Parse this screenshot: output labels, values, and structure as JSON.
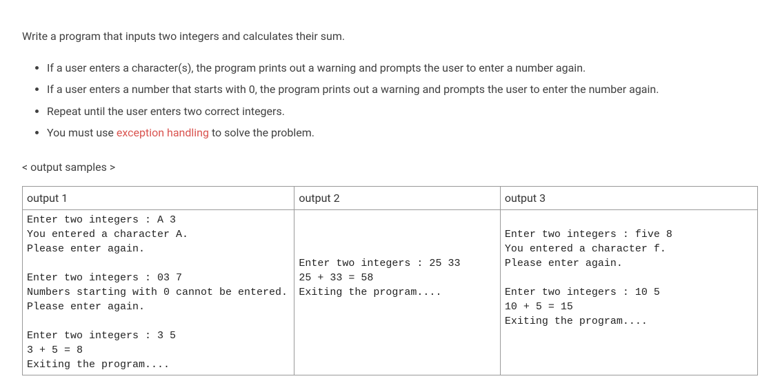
{
  "intro": "Write a program that inputs two integers and calculates their sum.",
  "bullets": {
    "b1": "If a user enters a character(s), the program prints out a warning and prompts the user to enter a number again.",
    "b2": "If a user enters a number that starts with 0, the program prints out a warning and prompts the user to enter the number again.",
    "b3": "Repeat until the user enters two correct integers.",
    "b4_prefix": "You must use ",
    "b4_highlight": "exception handling",
    "b4_suffix": " to solve the problem."
  },
  "samples_label": "< output samples >",
  "headers": {
    "h1": "output 1",
    "h2": "output 2",
    "h3": "output 3"
  },
  "outputs": {
    "o1": "Enter two integers : A 3\nYou entered a character A.\nPlease enter again.\n\nEnter two integers : 03 7\nNumbers starting with 0 cannot be entered.\nPlease enter again.\n\nEnter two integers : 3 5\n3 + 5 = 8\nExiting the program....",
    "o2": "\n\n\nEnter two integers : 25 33\n25 + 33 = 58\nExiting the program....",
    "o3": "\nEnter two integers : five 8\nYou entered a character f.\nPlease enter again.\n\nEnter two integers : 10 5\n10 + 5 = 15\nExiting the program...."
  }
}
